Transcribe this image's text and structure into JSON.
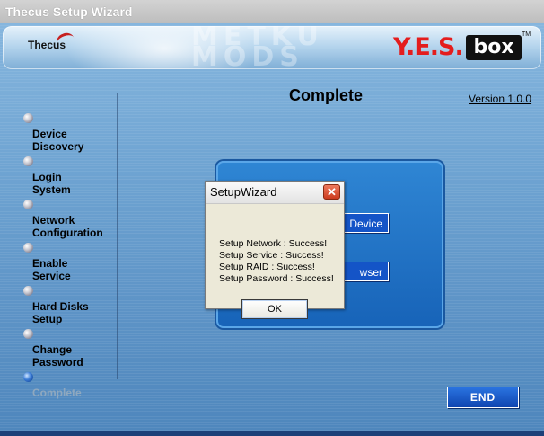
{
  "window": {
    "title": "Thecus Setup Wizard"
  },
  "banner": {
    "brand_logo": "Thecus",
    "product_logo": "Y.E.S.",
    "product_box": "box",
    "trademark": "TM",
    "watermark": "METKU MODS"
  },
  "header": {
    "title": "Complete",
    "version": "Version 1.0.0"
  },
  "steps": [
    {
      "label": "Device\nDiscovery"
    },
    {
      "label": "Login\nSystem"
    },
    {
      "label": "Network\nConfiguration"
    },
    {
      "label": "Enable\nService"
    },
    {
      "label": "Hard Disks\nSetup"
    },
    {
      "label": "Change\nPassword"
    },
    {
      "label": "Complete"
    }
  ],
  "panel": {
    "button_1_label": "Device",
    "button_2_label": "wser"
  },
  "dialog": {
    "title": "SetupWizard",
    "messages": [
      "Setup Network : Success!",
      "Setup Service : Success!",
      "Setup RAID : Success!",
      "Setup Password : Success!"
    ],
    "ok_label": "OK"
  },
  "footer": {
    "end_label": "END"
  }
}
